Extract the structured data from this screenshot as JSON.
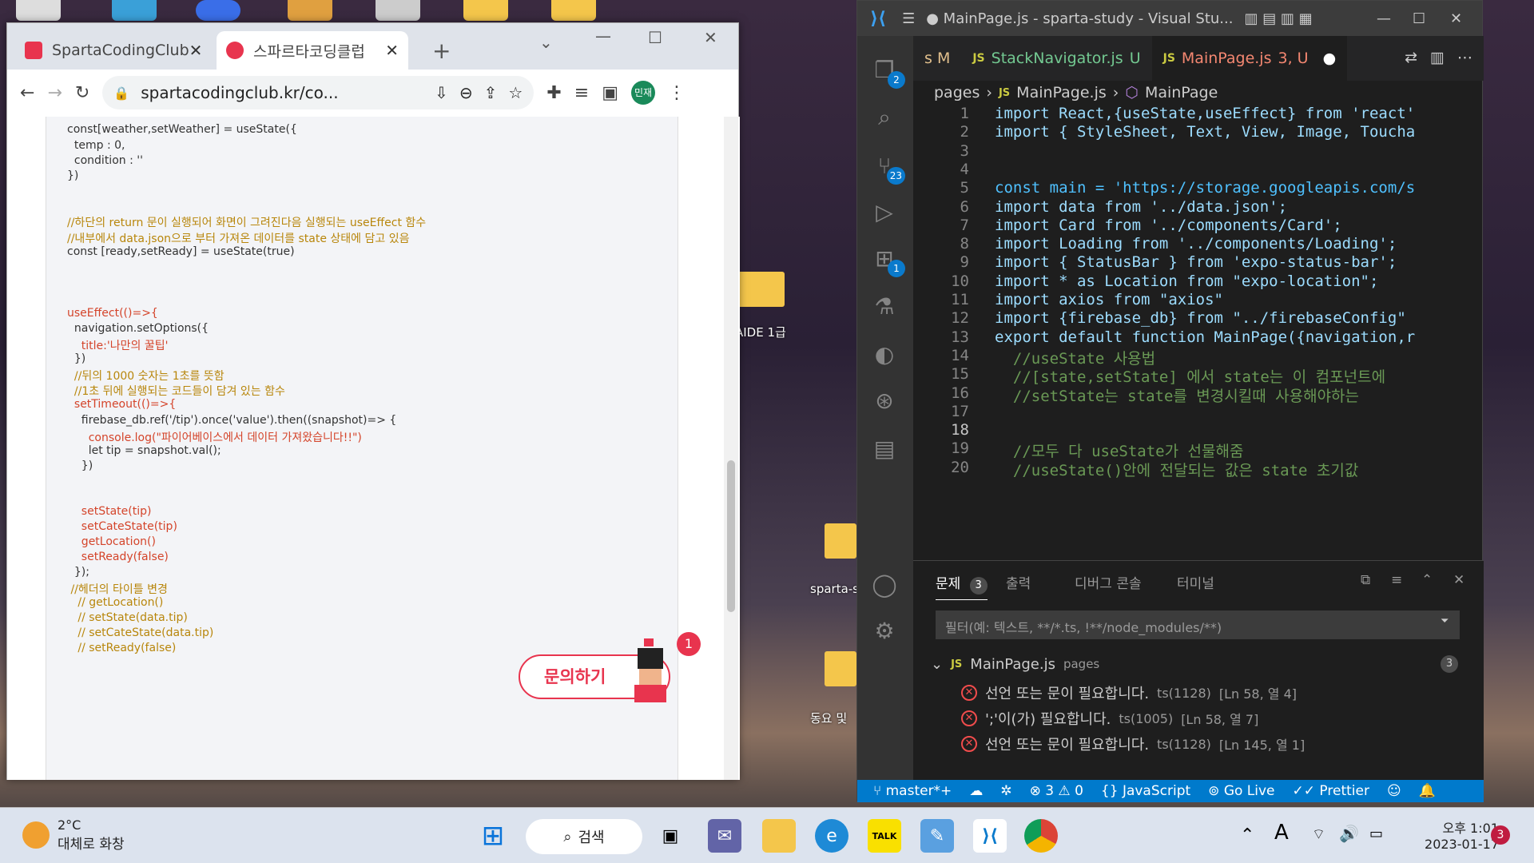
{
  "desktop": {
    "icons": [
      {
        "label": "AIDE 1급"
      },
      {
        "label": "sparta-s"
      },
      {
        "label": "동요 및"
      }
    ]
  },
  "chrome": {
    "tabs": [
      {
        "label": "SpartaCodingClub"
      },
      {
        "label": "스파르타코딩클럽"
      }
    ],
    "new_tab": "+",
    "url": "spartacodingclub.kr/co...",
    "profile": "민재",
    "code_lines": [
      "const[weather,setWeather] = useState({",
      "  temp : 0,",
      "  condition : ''",
      "})",
      "//하단의 return 문이 실행되어 화면이 그려진다음 실행되는 useEffect 함수",
      "//내부에서 data.json으로 부터 가져온 데이터를 state 상태에 담고 있음",
      "const [ready,setReady] = useState(true)",
      "useEffect(()=>{",
      "  navigation.setOptions({",
      "    title:'나만의 꿀팁'",
      "  })",
      "  //뒤의 1000 숫자는 1초를 뜻함",
      "  //1초 뒤에 실행되는 코드들이 담겨 있는 함수",
      "  setTimeout(()=>{",
      "    firebase_db.ref('/tip').once('value').then((snapshot)=> {",
      "      console.log(\"파이어베이스에서 데이터 가져왔습니다!!\")",
      "      let tip = snapshot.val();",
      "    })",
      "    setState(tip)",
      "    setCateState(tip)",
      "    getLocation()",
      "    setReady(false)",
      "  });",
      " //헤더의 타이틀 변경",
      "   // getLocation()",
      "   // setState(data.tip)",
      "   // setCateState(data.tip)",
      "   // setReady(false)"
    ],
    "inquiry_button": "문의하기",
    "inquiry_badge": "1"
  },
  "vscode": {
    "title": "● MainPage.js - sparta-study - Visual Stu...",
    "tabs": [
      {
        "label": "s  M"
      },
      {
        "label": "StackNavigator.js",
        "status": "U"
      },
      {
        "label": "MainPage.js",
        "status": "3, U"
      }
    ],
    "breadcrumb": [
      "pages",
      "MainPage.js",
      "MainPage"
    ],
    "activity_badges": {
      "explorer": "2",
      "scm": "23",
      "extensions": "1"
    },
    "lines": [
      {
        "n": "1",
        "html": "import React,{useState,useEffect} from 'react'"
      },
      {
        "n": "2",
        "html": "import { StyleSheet, Text, View, Image, Toucha"
      },
      {
        "n": "3",
        "html": ""
      },
      {
        "n": "4",
        "html": ""
      },
      {
        "n": "5",
        "html": "const main = 'https://storage.googleapis.com/s"
      },
      {
        "n": "6",
        "html": "import data from '../data.json';"
      },
      {
        "n": "7",
        "html": "import Card from '../components/Card';"
      },
      {
        "n": "8",
        "html": "import Loading from '../components/Loading';"
      },
      {
        "n": "9",
        "html": "import { StatusBar } from 'expo-status-bar';"
      },
      {
        "n": "10",
        "html": "import * as Location from \"expo-location\";"
      },
      {
        "n": "11",
        "html": "import axios from \"axios\""
      },
      {
        "n": "12",
        "html": "import {firebase_db} from \"../firebaseConfig\""
      },
      {
        "n": "13",
        "html": "export default function MainPage({navigation,r"
      },
      {
        "n": "14",
        "html": "  //useState 사용법"
      },
      {
        "n": "15",
        "html": "  //[state,setState] 에서 state는 이 컴포넌트에"
      },
      {
        "n": "16",
        "html": "  //setState는 state를 변경시킬때 사용해야하는 "
      },
      {
        "n": "17",
        "html": ""
      },
      {
        "n": "18",
        "html": ""
      },
      {
        "n": "19",
        "html": "  //모두 다 useState가 선물해줌"
      },
      {
        "n": "20",
        "html": "  //useState()안에 전달되는 값은 state 초기값"
      }
    ],
    "panel": {
      "tabs": [
        "문제",
        "출력",
        "디버그 콘솔",
        "터미널"
      ],
      "problem_count": "3",
      "filter_placeholder": "필터(예: 텍스트, **/*.ts, !**/node_modules/**)",
      "file": "MainPage.js",
      "file_dir": "pages",
      "file_count": "3",
      "problems": [
        {
          "msg": "선언 또는 문이 필요합니다.",
          "code": "ts(1128)",
          "loc": "[Ln 58, 열 4]"
        },
        {
          "msg": "';'이(가) 필요합니다.",
          "code": "ts(1005)",
          "loc": "[Ln 58, 열 7]"
        },
        {
          "msg": "선언 또는 문이 필요합니다.",
          "code": "ts(1128)",
          "loc": "[Ln 145, 열 1]"
        }
      ]
    },
    "status": {
      "branch": "master*+",
      "errors": "⊗ 3 ⚠ 0",
      "language": "JavaScript",
      "golive": "Go Live",
      "prettier": "Prettier"
    }
  },
  "taskbar": {
    "weather_temp": "2°C",
    "weather_desc": "대체로 화창",
    "search": "검색",
    "time": "오후 1:01",
    "date": "2023-01-17",
    "notif": "3",
    "ime": "A"
  }
}
